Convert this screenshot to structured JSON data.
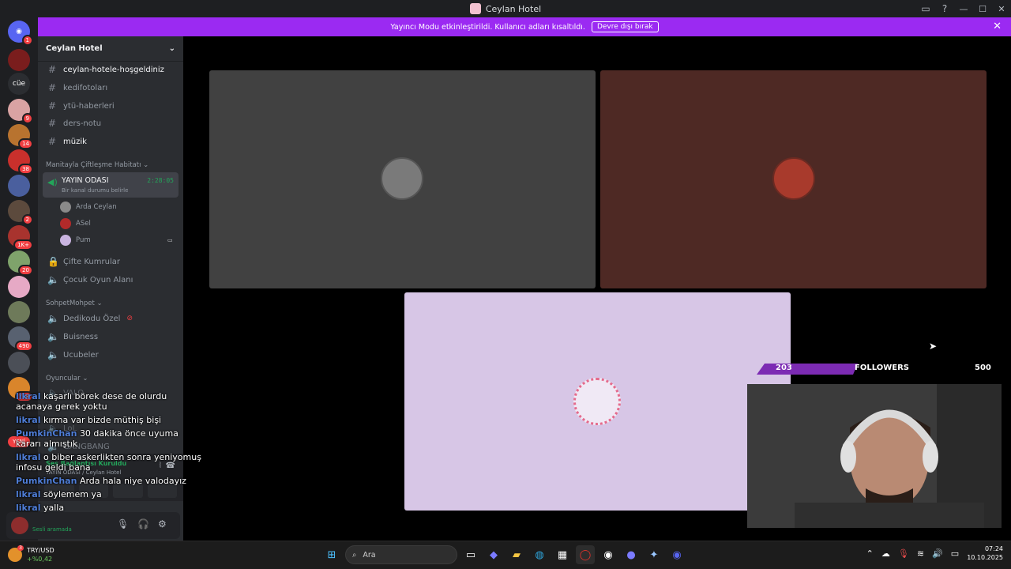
{
  "window": {
    "title": "Ceylan Hotel"
  },
  "notice": {
    "text": "Yayıncı Modu etkinleştirildi. Kullanıcı adları kısaltıldı.",
    "button": "Devre dışı bırak"
  },
  "guilds": [
    {
      "badge": "1"
    },
    {
      "badge": ""
    },
    {
      "label": "cüe",
      "badge": ""
    },
    {
      "badge": "9"
    },
    {
      "badge": "14"
    },
    {
      "badge": "38"
    },
    {
      "badge": ""
    },
    {
      "badge": "2"
    },
    {
      "badge": "1K+"
    },
    {
      "badge": "20"
    },
    {
      "badge": ""
    },
    {
      "badge": ""
    },
    {
      "badge": "490"
    },
    {
      "badge": ""
    },
    {
      "badge": "788"
    },
    {
      "label": "YENİ",
      "badge": ""
    }
  ],
  "sidebar": {
    "server_name": "Ceylan Hotel",
    "text_channels": [
      "ceylan-hotele-hoşgeldiniz",
      "kedifotoları",
      "ytü-haberleri",
      "ders-notu",
      "müzik"
    ],
    "category1": "Manitayla Çiftleşme Habitatı",
    "active_voice": {
      "name": "YAYIN ODASI",
      "status": "Bir kanal durumu belirle",
      "time": "2:28:05"
    },
    "voice_users": [
      "Arda Ceylan",
      "ASel",
      "Pum"
    ],
    "voice_channels1": [
      "Çifte Kumrular",
      "Çocuk Oyun Alanı"
    ],
    "category2": "SohpetMohpet",
    "voice_channels2": [
      "Dedikodu Özel",
      "Buisness",
      "Ucubeler"
    ],
    "category3": "Oyuncular",
    "voice_channels3": [
      "VALO",
      "LoL",
      "GANGBANG"
    ],
    "connection": {
      "title": "Ses Bağlantısı Kuruldu",
      "subtitle": "YAYIN ODASI / Ceylan Hotel"
    },
    "user": {
      "status": "Sesli aramada"
    }
  },
  "overlay": {
    "followers": {
      "current": "203",
      "label": "FOLLOWERS",
      "goal": "500",
      "progress": 0.406
    },
    "chat": [
      {
        "user": "likral",
        "msg": "kaşarlı börek dese de olurdu acanaya gerek yoktu"
      },
      {
        "user": "likral",
        "msg": "kırma var bizde müthiş bişi"
      },
      {
        "user": "PumkinChan",
        "msg": "30 dakika önce uyuma kararı almıştık"
      },
      {
        "user": "likral",
        "msg": "o biber askerlikten sonra yeniyomuş infosu geldi bana"
      },
      {
        "user": "PumkinChan",
        "msg": "Arda hala niye valodayız"
      },
      {
        "user": "likral",
        "msg": "söylemem ya"
      },
      {
        "user": "likral",
        "msg": "yalla"
      }
    ]
  },
  "taskbar": {
    "ticker": {
      "symbol": "TRY/USD",
      "change": "+%0,42",
      "badge": "3"
    },
    "search_placeholder": "Ara",
    "time": "07:24",
    "date": "10.10.2025"
  }
}
